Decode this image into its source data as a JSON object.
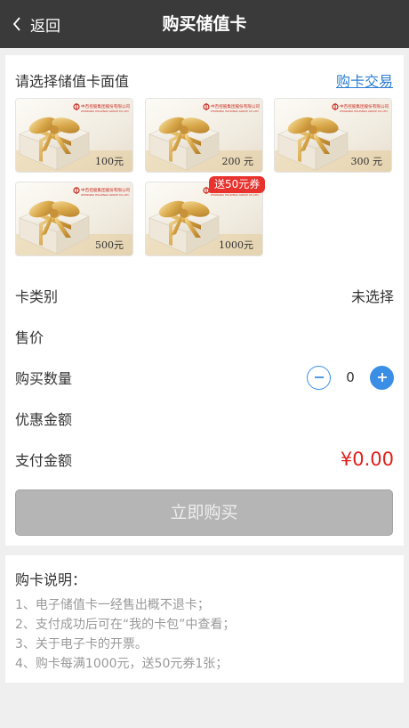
{
  "nav": {
    "back_label": "返回",
    "title": "购买储值卡"
  },
  "select": {
    "label": "请选择储值卡面值",
    "trade_link": "购卡交易"
  },
  "cards": [
    {
      "amount": "100元",
      "badge": ""
    },
    {
      "amount": "200 元",
      "badge": ""
    },
    {
      "amount": "300 元",
      "badge": ""
    },
    {
      "amount": "500元",
      "badge": ""
    },
    {
      "amount": "1000元",
      "badge": "送50元券"
    }
  ],
  "card_brand_text": "中百控股集团股份有限公司",
  "card_brand_text_en": "ZHONGBAI HOLDINGS GROUP CO.,LTD.",
  "form": {
    "card_type_label": "卡类别",
    "card_type_value": "未选择",
    "price_label": "售价",
    "price_value": "",
    "qty_label": "购买数量",
    "qty_value": "0",
    "discount_label": "优惠金额",
    "discount_value": "",
    "pay_label": "支付金额",
    "pay_value": "¥0.00"
  },
  "buy_button": "立即购买",
  "notes": {
    "title": "购卡说明：",
    "items": [
      "1、电子储值卡一经售出概不退卡；",
      "2、支付成功后可在“我的卡包”中查看；",
      "3、关于电子卡的开票。",
      "4、购卡每满1000元，送50元券1张；"
    ]
  },
  "colors": {
    "nav_bg": "#3a3a3a",
    "link_blue": "#2d7fd3",
    "accent_blue": "#3a8ee6",
    "price_red": "#e0201a",
    "badge_red": "#e8322e",
    "button_disabled": "#b5b5b5"
  }
}
